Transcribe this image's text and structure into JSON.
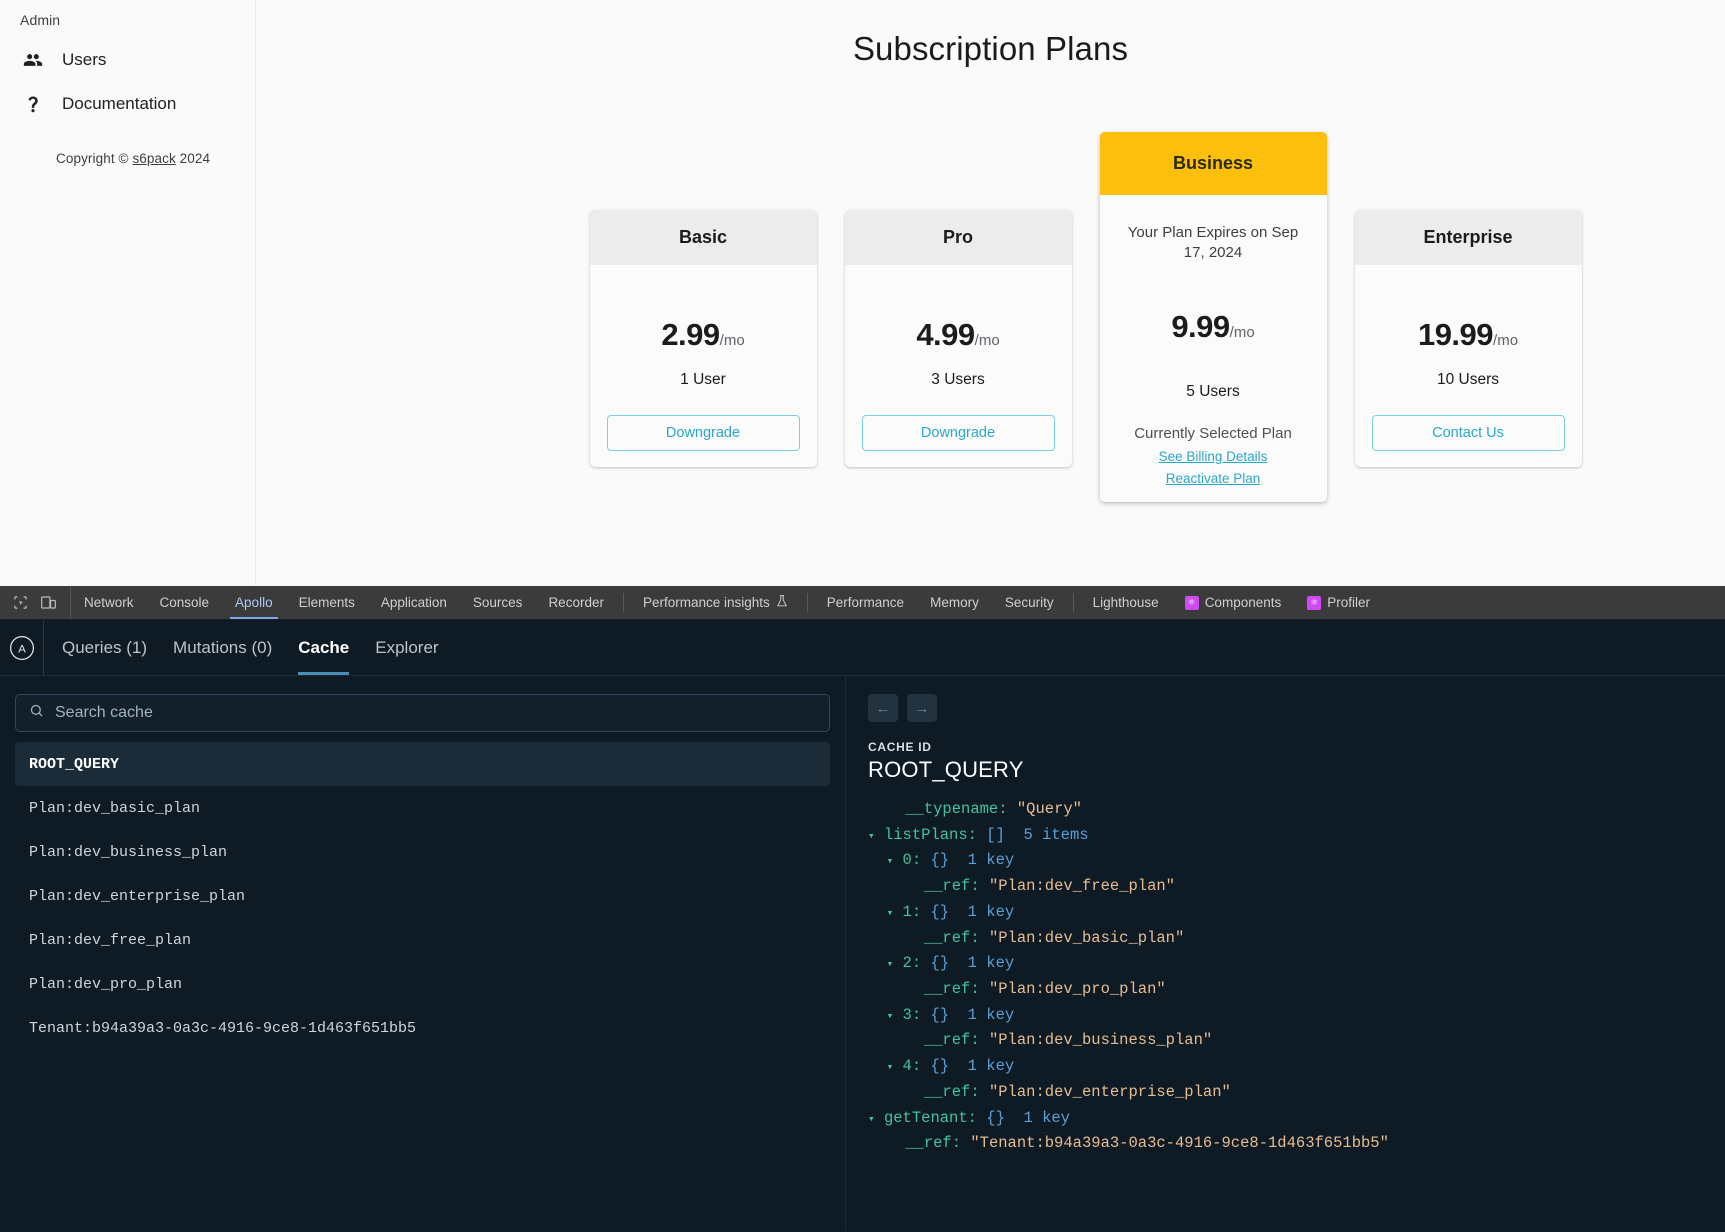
{
  "sidebar": {
    "title": "Admin",
    "items": [
      {
        "label": "Users",
        "icon": "users-icon"
      },
      {
        "label": "Documentation",
        "icon": "question-mark-icon"
      }
    ],
    "copyright_prefix": "Copyright © ",
    "copyright_link": "s6pack",
    "copyright_suffix": " 2024"
  },
  "main": {
    "page_title": "Subscription Plans",
    "plans": [
      {
        "name": "Basic",
        "price": "2.99",
        "unit": "/mo",
        "users": "1 User",
        "action": "Downgrade",
        "featured": false
      },
      {
        "name": "Pro",
        "price": "4.99",
        "unit": "/mo",
        "users": "3 Users",
        "action": "Downgrade",
        "featured": false
      },
      {
        "name": "Business",
        "expires": "Your Plan Expires on Sep 17, 2024",
        "price": "9.99",
        "unit": "/mo",
        "users": "5 Users",
        "status": "Currently Selected Plan",
        "link_billing": "See Billing Details",
        "link_reactivate": "Reactivate Plan",
        "featured": true
      },
      {
        "name": "Enterprise",
        "price": "19.99",
        "unit": "/mo",
        "users": "10 Users",
        "action": "Contact Us",
        "featured": false
      }
    ],
    "accent_color": "#2aa8c6",
    "featured_color": "#fcc00c"
  },
  "devtools": {
    "toolbar": {
      "tabs": [
        "Network",
        "Console",
        "Apollo",
        "Elements",
        "Application",
        "Sources",
        "Recorder"
      ],
      "performance_insights": "Performance insights",
      "tabs2": [
        "Performance",
        "Memory",
        "Security"
      ],
      "lighthouse": "Lighthouse",
      "react_tabs": [
        "Components",
        "Profiler"
      ],
      "active": "Apollo"
    },
    "apollo": {
      "tabs": [
        {
          "label": "Queries (1)",
          "active": false
        },
        {
          "label": "Mutations (0)",
          "active": false
        },
        {
          "label": "Cache",
          "active": true
        },
        {
          "label": "Explorer",
          "active": false
        }
      ]
    },
    "cache": {
      "search_placeholder": "Search cache",
      "search_value": "",
      "items": [
        {
          "label": "ROOT_QUERY",
          "selected": true
        },
        {
          "label": "Plan:dev_basic_plan",
          "selected": false
        },
        {
          "label": "Plan:dev_business_plan",
          "selected": false
        },
        {
          "label": "Plan:dev_enterprise_plan",
          "selected": false
        },
        {
          "label": "Plan:dev_free_plan",
          "selected": false
        },
        {
          "label": "Plan:dev_pro_plan",
          "selected": false
        },
        {
          "label": "Tenant:b94a39a3-0a3c-4916-9ce8-1d463f651bb5",
          "selected": false
        }
      ],
      "nav_back": "←",
      "nav_forward": "→",
      "cache_id_label": "CACHE ID",
      "cache_id_value": "ROOT_QUERY",
      "tree": [
        {
          "indent": 1,
          "arrow": "",
          "key": "__typename:",
          "meta": "",
          "value": "\"Query\""
        },
        {
          "indent": 0,
          "arrow": "▾",
          "key": "listPlans:",
          "meta": "[]  5 items",
          "value": ""
        },
        {
          "indent": 1,
          "arrow": "▾",
          "key": "0:",
          "meta": "{}  1 key",
          "value": ""
        },
        {
          "indent": 2,
          "arrow": "",
          "key": "__ref:",
          "meta": "",
          "value": "\"Plan:dev_free_plan\""
        },
        {
          "indent": 1,
          "arrow": "▾",
          "key": "1:",
          "meta": "{}  1 key",
          "value": ""
        },
        {
          "indent": 2,
          "arrow": "",
          "key": "__ref:",
          "meta": "",
          "value": "\"Plan:dev_basic_plan\""
        },
        {
          "indent": 1,
          "arrow": "▾",
          "key": "2:",
          "meta": "{}  1 key",
          "value": ""
        },
        {
          "indent": 2,
          "arrow": "",
          "key": "__ref:",
          "meta": "",
          "value": "\"Plan:dev_pro_plan\""
        },
        {
          "indent": 1,
          "arrow": "▾",
          "key": "3:",
          "meta": "{}  1 key",
          "value": ""
        },
        {
          "indent": 2,
          "arrow": "",
          "key": "__ref:",
          "meta": "",
          "value": "\"Plan:dev_business_plan\""
        },
        {
          "indent": 1,
          "arrow": "▾",
          "key": "4:",
          "meta": "{}  1 key",
          "value": ""
        },
        {
          "indent": 2,
          "arrow": "",
          "key": "__ref:",
          "meta": "",
          "value": "\"Plan:dev_enterprise_plan\""
        },
        {
          "indent": 0,
          "arrow": "▾",
          "key": "getTenant:",
          "meta": "{}  1 key",
          "value": ""
        },
        {
          "indent": 1,
          "arrow": "",
          "key": "__ref:",
          "meta": "",
          "value": "\"Tenant:b94a39a3-0a3c-4916-9ce8-1d463f651bb5\""
        }
      ]
    }
  }
}
